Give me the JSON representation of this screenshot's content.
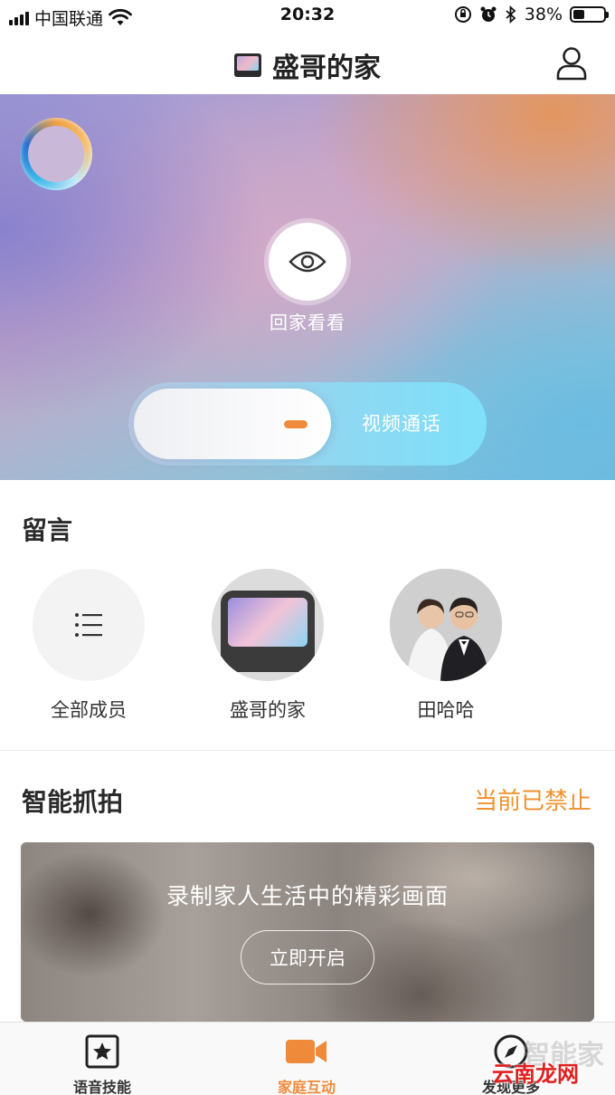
{
  "status_bar": {
    "carrier": "中国联通",
    "time": "20:32",
    "battery_percent": "38%",
    "battery_level": 0.38
  },
  "header": {
    "title": "盛哥的家"
  },
  "hero": {
    "eye_label": "回家看看",
    "slider_label": "视频通话"
  },
  "messages": {
    "title": "留言",
    "members": [
      {
        "name": "全部成员",
        "icon": "list-icon"
      },
      {
        "name": "盛哥的家",
        "icon": "smart-display-icon"
      },
      {
        "name": "田哈哈",
        "icon": "wedding-photo-avatar"
      }
    ]
  },
  "capture": {
    "title": "智能抓拍",
    "status": "当前已禁止",
    "prompt": "录制家人生活中的精彩画面",
    "button": "立即开启"
  },
  "tabbar": {
    "tabs": [
      {
        "label": "语音技能",
        "icon": "star-icon"
      },
      {
        "label": "家庭互动",
        "icon": "video-camera-icon",
        "active": true
      },
      {
        "label": "发现更多",
        "icon": "compass-icon"
      }
    ]
  },
  "watermark": {
    "text": "智能家",
    "text2": "云南龙网"
  },
  "colors": {
    "accent": "#ee8a3a",
    "status_link": "#f0922e"
  }
}
